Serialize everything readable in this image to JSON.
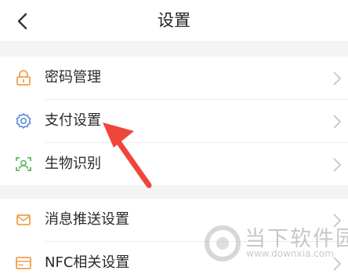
{
  "header": {
    "title": "设置",
    "back_icon": "chevron-left-icon"
  },
  "colors": {
    "accent_orange": "#f0a04b",
    "accent_blue": "#5b8bd6",
    "accent_green": "#5cb85c",
    "arrow_red": "#f0453a",
    "section_gap": "#f4f4f4"
  },
  "sections": [
    {
      "items": [
        {
          "label": "密码管理",
          "icon": "lock-icon"
        },
        {
          "label": "支付设置",
          "icon": "gear-icon"
        },
        {
          "label": "生物识别",
          "icon": "face-scan-icon"
        }
      ]
    },
    {
      "items": [
        {
          "label": "消息推送设置",
          "icon": "message-icon"
        },
        {
          "label": "NFC相关设置",
          "icon": "nfc-card-icon"
        }
      ]
    }
  ],
  "watermark": {
    "name": "当下软件园",
    "url": "www.downxia.com"
  }
}
